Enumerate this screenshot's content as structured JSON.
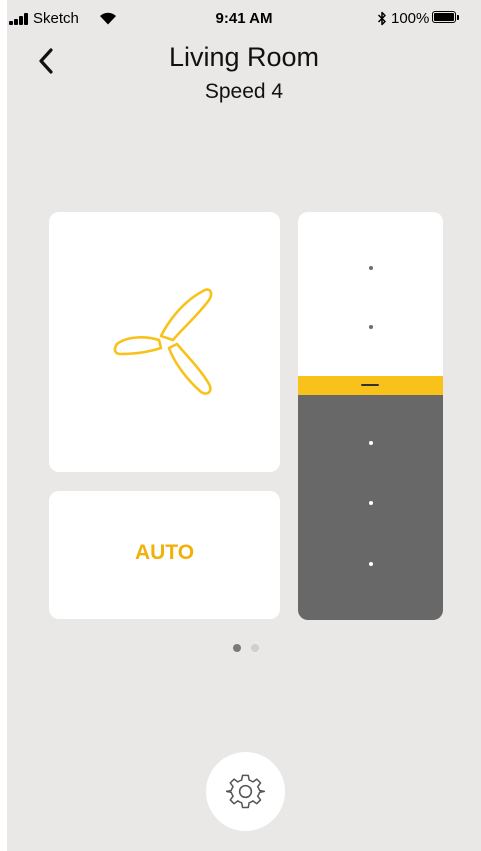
{
  "status_bar": {
    "carrier": "Sketch",
    "time": "9:41 AM",
    "battery_percent": "100%",
    "icons": [
      "signal-bars-icon",
      "wifi-icon",
      "bluetooth-icon",
      "battery-icon"
    ]
  },
  "header": {
    "title": "Living Room",
    "subtitle": "Speed 4",
    "back_icon": "chevron-left-icon"
  },
  "fan_card": {
    "icon": "fan-blades-icon",
    "accent_color": "#F9C21A"
  },
  "auto_card": {
    "label": "AUTO",
    "label_color": "#F0B20A"
  },
  "speed_slider": {
    "levels": 5,
    "current_level": 4,
    "handle_color": "#F9C21A",
    "active_fill_color": "#686868"
  },
  "pager": {
    "page_count": 2,
    "current_page": 1
  },
  "settings_button": {
    "icon": "gear-icon"
  }
}
